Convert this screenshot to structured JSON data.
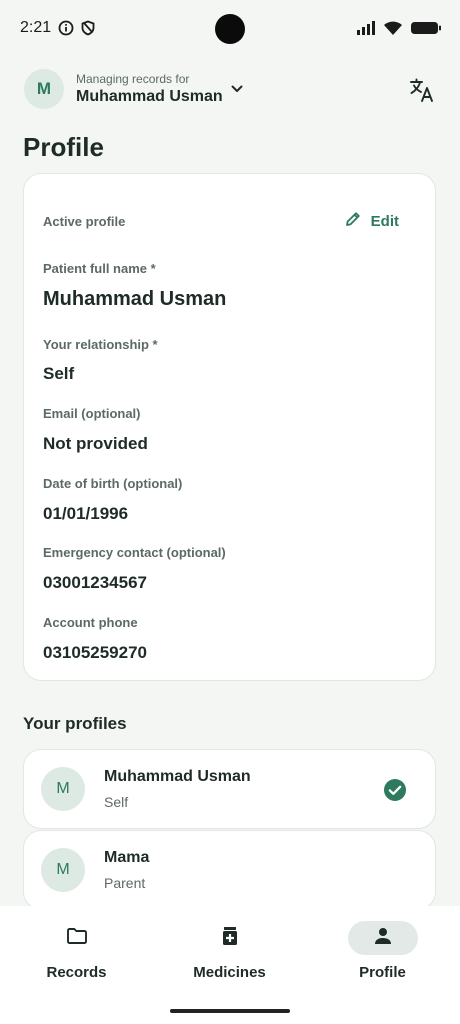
{
  "status_bar": {
    "time": "2:21",
    "icons_left": [
      "info-circle-icon",
      "shield-icon"
    ],
    "icons_right": [
      "signal-icon",
      "wifi-icon",
      "battery-icon"
    ]
  },
  "header": {
    "avatar_initial": "M",
    "caption": "Managing records for",
    "name": "Muhammad Usman",
    "switch_icon": "chevron-down-icon",
    "translate_icon": "translate-icon"
  },
  "page": {
    "title": "Profile"
  },
  "active_profile": {
    "label": "Active profile",
    "edit_label": "Edit",
    "fields": [
      {
        "label": "Patient full name *",
        "value": "Muhammad Usman"
      },
      {
        "label": "Your relationship *",
        "value": "Self"
      },
      {
        "label": "Email (optional)",
        "value": "Not provided"
      },
      {
        "label": "Date of birth (optional)",
        "value": "01/01/1996"
      },
      {
        "label": "Emergency contact (optional)",
        "value": "03001234567"
      },
      {
        "label": "Account phone",
        "value": "03105259270"
      }
    ]
  },
  "your_profiles": {
    "title": "Your profiles",
    "items": [
      {
        "initial": "M",
        "name": "Muhammad Usman",
        "relationship": "Self",
        "selected": true
      },
      {
        "initial": "M",
        "name": "Mama",
        "relationship": "Parent",
        "selected": false
      }
    ]
  },
  "bottom_nav": {
    "items": [
      {
        "label": "Records",
        "icon": "folder-icon",
        "active": false
      },
      {
        "label": "Medicines",
        "icon": "medicine-icon",
        "active": false
      },
      {
        "label": "Profile",
        "icon": "person-icon",
        "active": true
      }
    ]
  },
  "colors": {
    "accent": "#2d7a5f",
    "avatar_bg": "#dde9e3",
    "background": "#f4f6f4",
    "text": "#1e2b26"
  }
}
